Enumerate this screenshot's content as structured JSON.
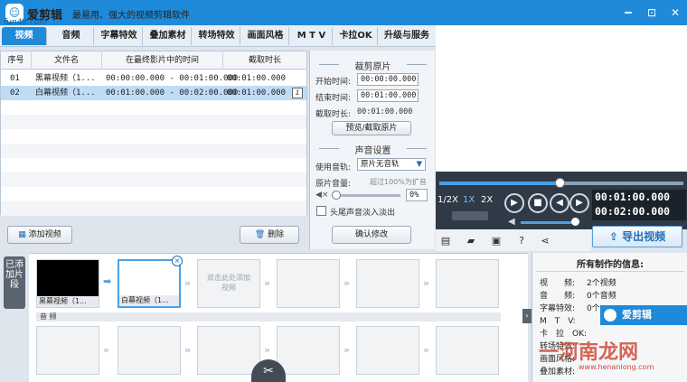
{
  "app": {
    "title": "爱剪辑",
    "slogan": "最易用、强大的视频剪辑软件",
    "watermark": "fun48.com"
  },
  "window_controls": {
    "minimize": "━",
    "maximize": "⊡",
    "close": "✕"
  },
  "tabs": [
    "视频",
    "音频",
    "字幕特效",
    "叠加素材",
    "转场特效",
    "画面风格",
    "M T V",
    "卡拉OK",
    "升级与服务"
  ],
  "list": {
    "headers": [
      "序号",
      "文件名",
      "在最终影片中的时间",
      "截取时长"
    ],
    "rows": [
      {
        "no": "01",
        "name": "黑幕视频（1...",
        "time": "00:00:00.000 - 00:01:00.000",
        "dur": "00:01:00.000"
      },
      {
        "no": "02",
        "name": "白幕视频（1...",
        "time": "00:01:00.000 - 00:02:00.000",
        "dur": "00:01:00.000"
      }
    ],
    "info_icon": "i"
  },
  "buttons": {
    "add_video": "添加视频",
    "delete": "删除"
  },
  "crop": {
    "title": "裁剪原片",
    "start_label": "开始时间:",
    "start_value": "00:00:00.000",
    "end_label": "结束时间:",
    "end_value": "00:01:00.000",
    "dur_label": "截取时长:",
    "dur_value": "00:01:00.000",
    "preview_btn": "预览/截取原片"
  },
  "sound": {
    "title": "声音设置",
    "track_label": "使用音轨:",
    "track_value": "原片无音轨",
    "volume_label": "原片音量:",
    "volume_hint": "超过100%为扩音",
    "volume_value": "0%",
    "fade_label": "头尾声音淡入淡出",
    "confirm_btn": "确认修改"
  },
  "player": {
    "speeds": [
      "1/2X",
      "1X",
      "2X"
    ],
    "current_time": "00:01:00.000",
    "total_time": "00:02:00.000",
    "progress": 0.5,
    "export_label": "导出视频"
  },
  "timeline": {
    "side_label": "已添加片段",
    "clips": [
      {
        "caption": "黑幕视频（1..."
      },
      {
        "caption": "白幕视频（1..."
      }
    ],
    "placeholder": "双击此处添加视频",
    "audio_label": "音 频"
  },
  "info_panel": {
    "title": "所有制作的信息:",
    "rows": [
      {
        "label": "视　　频:",
        "value": "2个视频"
      },
      {
        "label": "音　　频:",
        "value": "0个音频"
      },
      {
        "label": "字幕特效:",
        "value": "0个"
      },
      {
        "label": "M　T　V:",
        "value": ""
      },
      {
        "label": "卡　拉　OK:",
        "value": ""
      },
      {
        "label": "转场特效:",
        "value": ""
      },
      {
        "label": "画面风格:",
        "value": ""
      },
      {
        "label": "叠加素材:",
        "value": ""
      }
    ],
    "popup_title": "爱剪辑"
  },
  "watermark2": {
    "text": "一河南龙网",
    "sub": "www.henanlong.com"
  }
}
